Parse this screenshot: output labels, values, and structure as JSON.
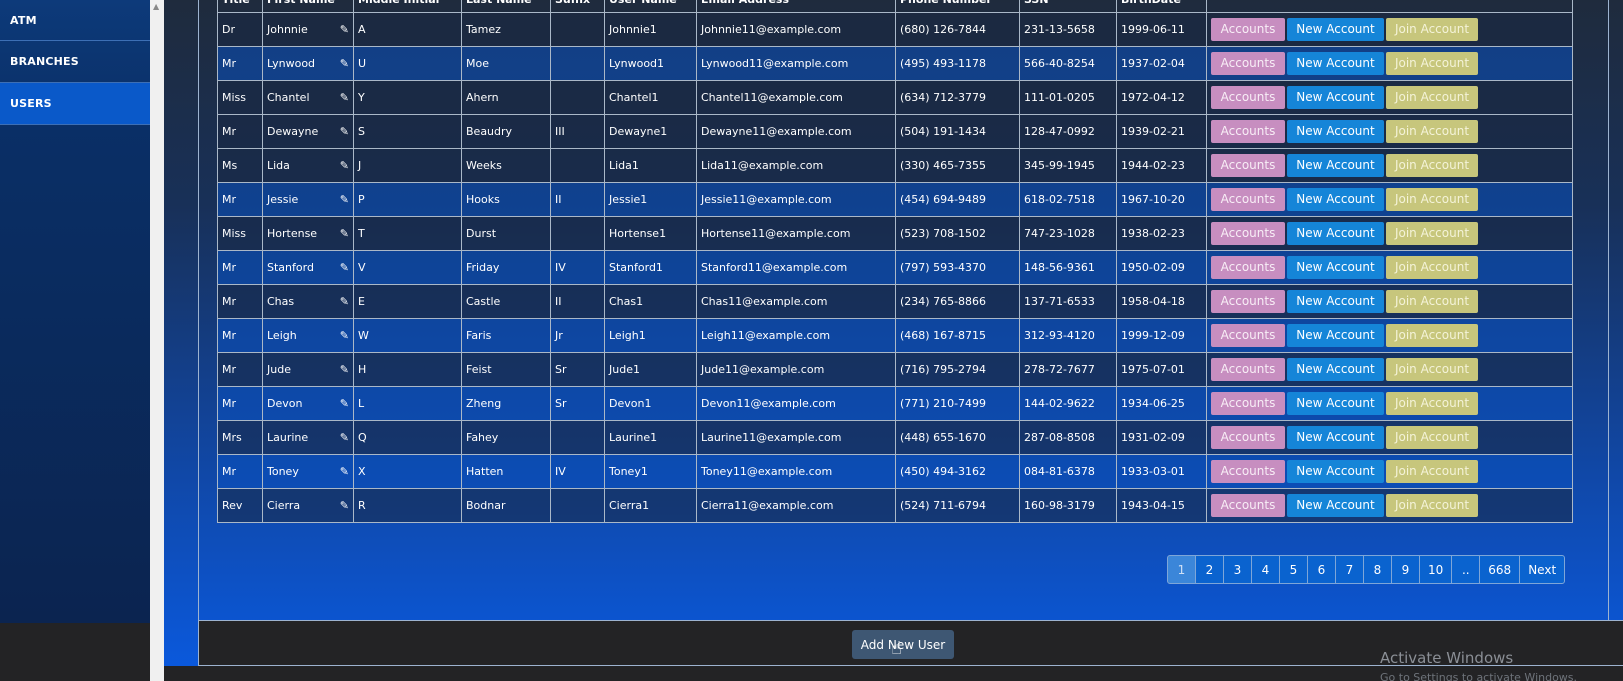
{
  "sidebar": {
    "items": [
      {
        "label": "ATM"
      },
      {
        "label": "BRANCHES"
      },
      {
        "label": "USERS"
      }
    ]
  },
  "table": {
    "headers": [
      "Title",
      "First Name",
      "Middle Initial",
      "Last Name",
      "Suffix",
      "User Name",
      "Email Address",
      "Phone Number",
      "SSN",
      "BirthDate",
      ""
    ],
    "buttons": {
      "accounts": "Accounts",
      "new_account": "New Account",
      "join_account": "Join Account"
    },
    "rows": [
      {
        "title": "Dr",
        "first": "Johnnie",
        "mi": "A",
        "last": "Tamez",
        "suffix": "",
        "user": "Johnnie1",
        "email": "Johnnie11@example.com",
        "phone": "(680) 126-7844",
        "ssn": "231-13-5658",
        "birth": "1999-06-11"
      },
      {
        "title": "Mr",
        "first": "Lynwood",
        "mi": "U",
        "last": "Moe",
        "suffix": "",
        "user": "Lynwood1",
        "email": "Lynwood11@example.com",
        "phone": "(495) 493-1178",
        "ssn": "566-40-8254",
        "birth": "1937-02-04"
      },
      {
        "title": "Miss",
        "first": "Chantel",
        "mi": "Y",
        "last": "Ahern",
        "suffix": "",
        "user": "Chantel1",
        "email": "Chantel11@example.com",
        "phone": "(634) 712-3779",
        "ssn": "111-01-0205",
        "birth": "1972-04-12"
      },
      {
        "title": "Mr",
        "first": "Dewayne",
        "mi": "S",
        "last": "Beaudry",
        "suffix": "III",
        "user": "Dewayne1",
        "email": "Dewayne11@example.com",
        "phone": "(504) 191-1434",
        "ssn": "128-47-0992",
        "birth": "1939-02-21"
      },
      {
        "title": "Ms",
        "first": "Lida",
        "mi": "J",
        "last": "Weeks",
        "suffix": "",
        "user": "Lida1",
        "email": "Lida11@example.com",
        "phone": "(330) 465-7355",
        "ssn": "345-99-1945",
        "birth": "1944-02-23"
      },
      {
        "title": "Mr",
        "first": "Jessie",
        "mi": "P",
        "last": "Hooks",
        "suffix": "II",
        "user": "Jessie1",
        "email": "Jessie11@example.com",
        "phone": "(454) 694-9489",
        "ssn": "618-02-7518",
        "birth": "1967-10-20"
      },
      {
        "title": "Miss",
        "first": "Hortense",
        "mi": "T",
        "last": "Durst",
        "suffix": "",
        "user": "Hortense1",
        "email": "Hortense11@example.com",
        "phone": "(523) 708-1502",
        "ssn": "747-23-1028",
        "birth": "1938-02-23"
      },
      {
        "title": "Mr",
        "first": "Stanford",
        "mi": "V",
        "last": "Friday",
        "suffix": "IV",
        "user": "Stanford1",
        "email": "Stanford11@example.com",
        "phone": "(797) 593-4370",
        "ssn": "148-56-9361",
        "birth": "1950-02-09"
      },
      {
        "title": "Mr",
        "first": "Chas",
        "mi": "E",
        "last": "Castle",
        "suffix": "II",
        "user": "Chas1",
        "email": "Chas11@example.com",
        "phone": "(234) 765-8866",
        "ssn": "137-71-6533",
        "birth": "1958-04-18"
      },
      {
        "title": "Mr",
        "first": "Leigh",
        "mi": "W",
        "last": "Faris",
        "suffix": "Jr",
        "user": "Leigh1",
        "email": "Leigh11@example.com",
        "phone": "(468) 167-8715",
        "ssn": "312-93-4120",
        "birth": "1999-12-09"
      },
      {
        "title": "Mr",
        "first": "Jude",
        "mi": "H",
        "last": "Feist",
        "suffix": "Sr",
        "user": "Jude1",
        "email": "Jude11@example.com",
        "phone": "(716) 795-2794",
        "ssn": "278-72-7677",
        "birth": "1975-07-01"
      },
      {
        "title": "Mr",
        "first": "Devon",
        "mi": "L",
        "last": "Zheng",
        "suffix": "Sr",
        "user": "Devon1",
        "email": "Devon11@example.com",
        "phone": "(771) 210-7499",
        "ssn": "144-02-9622",
        "birth": "1934-06-25"
      },
      {
        "title": "Mrs",
        "first": "Laurine",
        "mi": "Q",
        "last": "Fahey",
        "suffix": "",
        "user": "Laurine1",
        "email": "Laurine11@example.com",
        "phone": "(448) 655-1670",
        "ssn": "287-08-8508",
        "birth": "1931-02-09"
      },
      {
        "title": "Mr",
        "first": "Toney",
        "mi": "X",
        "last": "Hatten",
        "suffix": "IV",
        "user": "Toney1",
        "email": "Toney11@example.com",
        "phone": "(450) 494-3162",
        "ssn": "084-81-6378",
        "birth": "1933-03-01"
      },
      {
        "title": "Rev",
        "first": "Cierra",
        "mi": "R",
        "last": "Bodnar",
        "suffix": "",
        "user": "Cierra1",
        "email": "Cierra11@example.com",
        "phone": "(524) 711-6794",
        "ssn": "160-98-3179",
        "birth": "1943-04-15"
      }
    ]
  },
  "pagination": {
    "pages": [
      "1",
      "2",
      "3",
      "4",
      "5",
      "6",
      "7",
      "8",
      "9",
      "10",
      "..",
      "668"
    ],
    "active": "1",
    "next": "Next"
  },
  "footer": {
    "add_user": "Add New User"
  },
  "watermark": {
    "line1": "Activate Windows",
    "line2": "Go to Settings to activate Windows."
  },
  "colors": {
    "accounts": "#c78ec0",
    "new_account": "#1585d8",
    "join_account": "#c7c67c",
    "active_nav": "#0a59c9"
  }
}
